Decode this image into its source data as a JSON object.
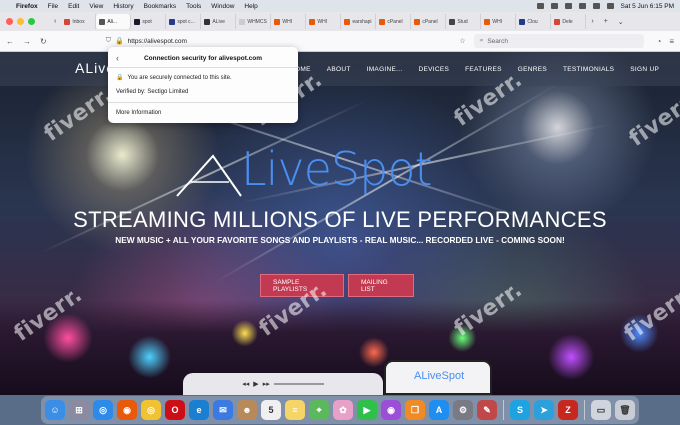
{
  "menubar": {
    "app_name": "Firefox",
    "items": [
      "File",
      "Edit",
      "View",
      "History",
      "Bookmarks",
      "Tools",
      "Window",
      "Help"
    ],
    "clock": "Sat 5 Jun 6:15 PM"
  },
  "tabs": [
    {
      "label": "Inbox",
      "color": "#d44638"
    },
    {
      "label": "Ali...",
      "color": "#555555",
      "active": true
    },
    {
      "label": "spot",
      "color": "#1a1a2e"
    },
    {
      "label": "spot c...",
      "color": "#2a3a8a"
    },
    {
      "label": "ALive",
      "color": "#333333"
    },
    {
      "label": "WHMCS",
      "color": "#cccccc"
    },
    {
      "label": "WHI",
      "color": "#e8590c"
    },
    {
      "label": "WHI",
      "color": "#e8590c"
    },
    {
      "label": "earshapi",
      "color": "#e8590c"
    },
    {
      "label": "cPanel",
      "color": "#e8590c"
    },
    {
      "label": "cPanel",
      "color": "#e8590c"
    },
    {
      "label": "Stud",
      "color": "#444444"
    },
    {
      "label": "WHI",
      "color": "#e8590c"
    },
    {
      "label": "Clou",
      "color": "#1e3a8a"
    },
    {
      "label": "Dele",
      "color": "#d44638"
    }
  ],
  "navbar": {
    "url": "https://alivespot.com",
    "search_placeholder": "Search"
  },
  "popup": {
    "title": "Connection security for alivespot.com",
    "secure_text": "You are securely connected to this site.",
    "verified_text": "Verified by: Sectigo Limited",
    "more_info": "More Information"
  },
  "site": {
    "logo_text": "ALive",
    "nav": [
      "HOME",
      "ABOUT",
      "IMAGINE...",
      "DEVICES",
      "FEATURES",
      "GENRES",
      "TESTIMONIALS",
      "SIGN UP"
    ],
    "brand_word": "LiveSpot",
    "headline": "STREAMING MILLIONS OF LIVE PERFORMANCES",
    "subline": "NEW MUSIC + ALL YOUR FAVORITE SONGS AND PLAYLISTS - REAL MUSIC... RECORDED LIVE - COMING SOON!",
    "btn_playlists": "SAMPLE PLAYLISTS",
    "btn_mailing": "MAILING LIST",
    "mini_brand": "ALiveSpot"
  },
  "watermark": "fiverr.",
  "dock": [
    {
      "name": "finder",
      "color": "#3a8ee6",
      "glyph": "☺"
    },
    {
      "name": "launchpad",
      "color": "#8a8aa0",
      "glyph": "⊞"
    },
    {
      "name": "safari",
      "color": "#2d8ae8",
      "glyph": "◎"
    },
    {
      "name": "firefox",
      "color": "#e8590c",
      "glyph": "◉"
    },
    {
      "name": "chrome",
      "color": "#f1c232",
      "glyph": "◎"
    },
    {
      "name": "opera",
      "color": "#cc0f16",
      "glyph": "O"
    },
    {
      "name": "edge",
      "color": "#1a7fd0",
      "glyph": "e"
    },
    {
      "name": "mail",
      "color": "#3b7ae0",
      "glyph": "✉"
    },
    {
      "name": "contacts",
      "color": "#b88a5a",
      "glyph": "☻"
    },
    {
      "name": "calendar",
      "color": "#f0f0f0",
      "glyph": "5"
    },
    {
      "name": "notes",
      "color": "#f5d565",
      "glyph": "≡"
    },
    {
      "name": "maps",
      "color": "#5cb85c",
      "glyph": "⌖"
    },
    {
      "name": "photos",
      "color": "#e8a0c8",
      "glyph": "✿"
    },
    {
      "name": "facetime",
      "color": "#2ec04a",
      "glyph": "▶"
    },
    {
      "name": "podcasts",
      "color": "#9b4fd8",
      "glyph": "◉"
    },
    {
      "name": "books",
      "color": "#f08a24",
      "glyph": "❐"
    },
    {
      "name": "app-store",
      "color": "#1f8ef1",
      "glyph": "A"
    },
    {
      "name": "system-preferences",
      "color": "#7a7a84",
      "glyph": "⚙"
    },
    {
      "name": "photo-editor",
      "color": "#c04848",
      "glyph": "✎"
    },
    {
      "name": "skype",
      "color": "#1fa3e0",
      "glyph": "S"
    },
    {
      "name": "telegram",
      "color": "#2ba0dd",
      "glyph": "➤"
    },
    {
      "name": "filezilla",
      "color": "#c7271f",
      "glyph": "Z"
    },
    {
      "name": "downloads",
      "color": "#d0d4dc",
      "glyph": "▭"
    },
    {
      "name": "trash",
      "color": "#c8ccd4",
      "glyph": "🗑"
    }
  ]
}
